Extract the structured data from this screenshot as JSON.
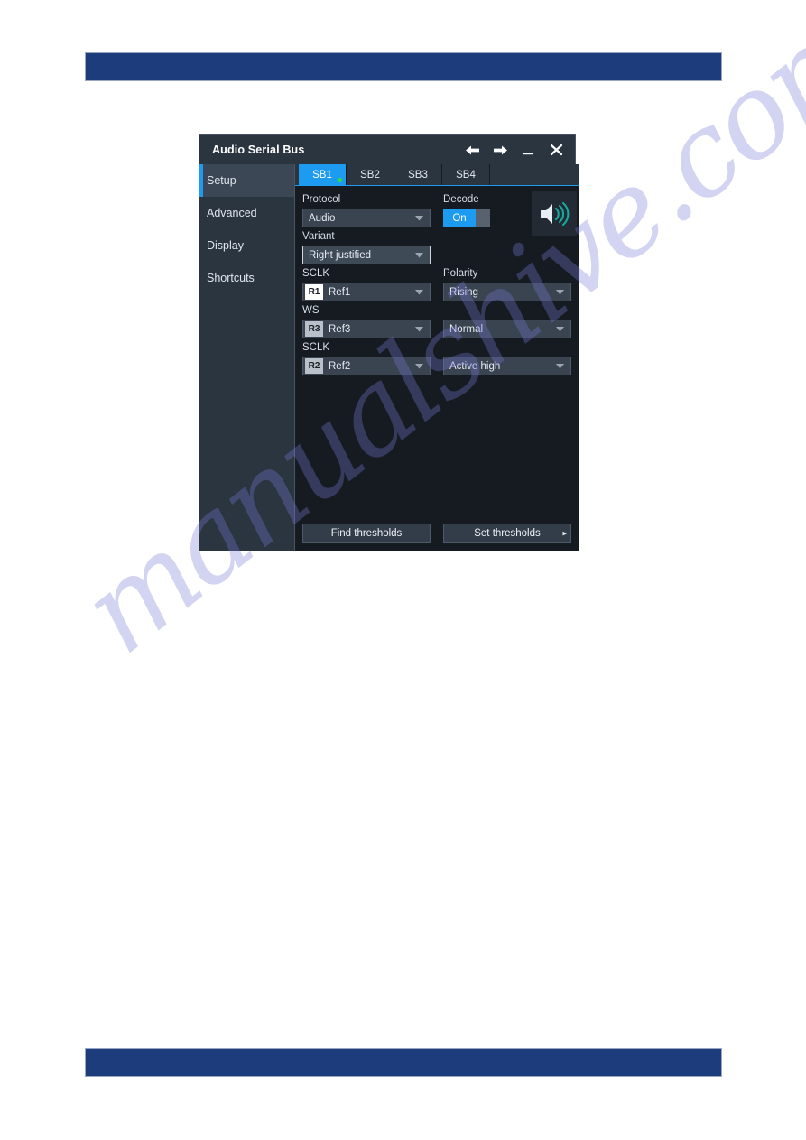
{
  "page": {
    "header_bar_color": "#1d3c7c",
    "footer_bar_color": "#1d3c7c",
    "watermark_text": "manualshive.com"
  },
  "dialog": {
    "title": "Audio Serial Bus",
    "window_buttons": [
      "back-arrow",
      "forward-arrow",
      "minimize",
      "close"
    ],
    "sidebar": {
      "items": [
        {
          "label": "Setup",
          "active": true
        },
        {
          "label": "Advanced",
          "active": false
        },
        {
          "label": "Display",
          "active": false
        },
        {
          "label": "Shortcuts",
          "active": false
        }
      ]
    },
    "tabs": [
      {
        "label": "SB1",
        "active": true,
        "indicator": "green-dot"
      },
      {
        "label": "SB2",
        "active": false
      },
      {
        "label": "SB3",
        "active": false
      },
      {
        "label": "SB4",
        "active": false
      }
    ],
    "form": {
      "protocol": {
        "label": "Protocol",
        "value": "Audio"
      },
      "decode": {
        "label": "Decode",
        "value": "On"
      },
      "speaker_icon": "speaker-icon",
      "variant": {
        "label": "Variant",
        "value": "Right justified"
      },
      "sclk1": {
        "label": "SCLK",
        "badge": "R1",
        "value": "Ref1"
      },
      "polarity": {
        "label": "Polarity",
        "value": "Rising"
      },
      "ws": {
        "label": "WS",
        "badge": "R3",
        "value": "Ref3"
      },
      "ws_mode": {
        "label": "",
        "value": "Normal"
      },
      "sclk2": {
        "label": "SCLK",
        "badge": "R2",
        "value": "Ref2"
      },
      "sclk2_mode": {
        "label": "",
        "value": "Active high"
      }
    },
    "buttons": {
      "find_thresholds": "Find thresholds",
      "set_thresholds": "Set thresholds",
      "set_thresholds_arrow": "▸"
    }
  }
}
